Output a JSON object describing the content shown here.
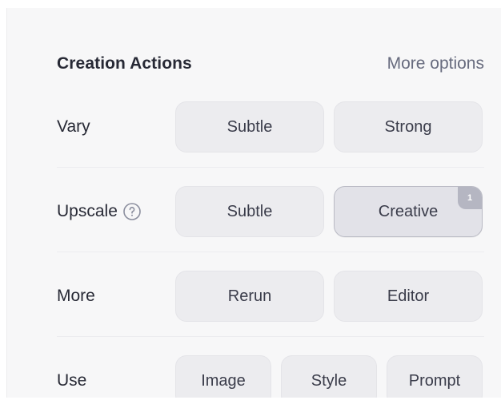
{
  "header": {
    "title": "Creation Actions",
    "more_options": "More options"
  },
  "rows": [
    {
      "label": "Vary",
      "buttons": [
        {
          "label": "Subtle"
        },
        {
          "label": "Strong"
        }
      ]
    },
    {
      "label": "Upscale",
      "help_icon": "question-circle-icon",
      "buttons": [
        {
          "label": "Subtle"
        },
        {
          "label": "Creative",
          "badge": "1",
          "active": true
        }
      ]
    },
    {
      "label": "More",
      "buttons": [
        {
          "label": "Rerun"
        },
        {
          "label": "Editor"
        }
      ]
    },
    {
      "label": "Use",
      "buttons": [
        {
          "label": "Image"
        },
        {
          "label": "Style"
        },
        {
          "label": "Prompt"
        }
      ]
    }
  ],
  "colors": {
    "panel_bg": "#f7f7f8",
    "button_bg": "#ececef",
    "active_border": "#b9bac4",
    "badge_bg": "#b5b6c2",
    "text": "#272935",
    "muted_text": "#676b7e"
  }
}
